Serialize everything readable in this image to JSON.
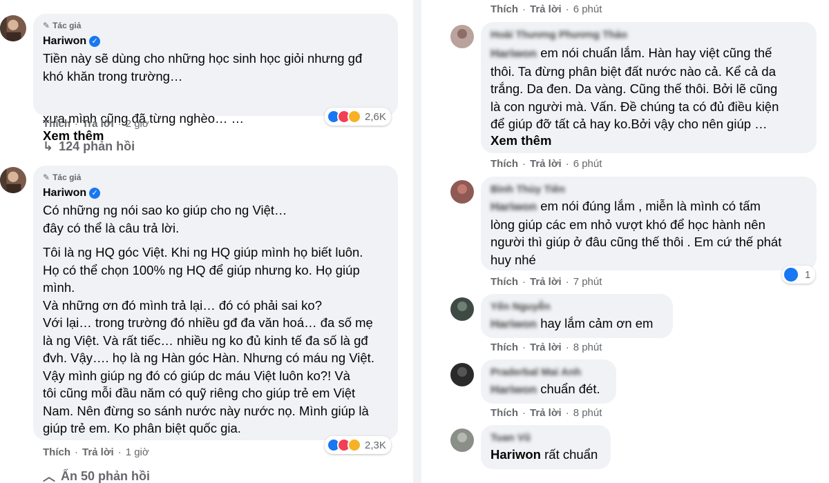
{
  "left": {
    "comments": [
      {
        "author_badge": "Tác giả",
        "author": "Hariwon",
        "paragraphs": [
          "Tiền này sẽ dùng cho những học sinh học giỏi nhưng gđ\nkhó khăn trong trường…",
          "xưa mình cũng đã từng nghèo… …"
        ],
        "see_more": "Xem thêm",
        "like": "Thích",
        "reply": "Trả lời",
        "time": "2 giờ",
        "reaction_count": "2,6K",
        "replies_label": "124 phản hồi"
      },
      {
        "author_badge": "Tác giả",
        "author": "Hariwon",
        "paragraphs": [
          "Có những ng nói sao ko giúp cho ng Việt…\nđây có thể là câu trả lời.",
          "Tôi là ng HQ góc Việt. Khi ng HQ giúp mình họ biết luôn.\nHọ có thể chọn 100% ng HQ để giúp nhưng ko. Họ giúp\nmình.\nVà những ơn đó mình trả lại… đó có phải sai ko?\nVới lại… trong trường đó nhiều gđ đa văn hoá… đa số mẹ\nlà ng Việt. Và rất tiếc… nhiều ng ko đủ kinh tế đa số là gđ\nđvh. Vậy…. họ là ng Hàn góc Hàn. Nhưng có máu ng Việt.\nVậy mình giúp ng đó có giúp dc máu Việt luôn ko?! Và\ntôi cũng mỗi đầu năm có quỹ riêng cho giúp trẻ em Việt\nNam. Nên đừng so sánh nước này nước nọ. Mình giúp là\ngiúp trẻ em. Ko phân biệt quốc gia."
        ],
        "like": "Thích",
        "reply": "Trả lời",
        "time": "1 giờ",
        "reaction_count": "2,3K",
        "replies_label": "Ẩn 50 phản hồi"
      }
    ]
  },
  "right": {
    "top_meta": {
      "like": "Thích",
      "reply": "Trả lời",
      "time": "6 phút"
    },
    "comments": [
      {
        "name": "Hoài Thương Phương Thảo",
        "mention": "Hariwon",
        "text": " em nói chuẩn lắm. Hàn hay việt cũng thế\nthôi. Ta đừng phân biệt đất nước nào cả. Kể cả da\ntrắng. Da đen. Da vàng. Cũng thế thôi. Bởi lẽ cũng\nlà con người mà. Vấn. Đề chúng ta có đủ điều kiện\nđể giúp đỡ tất cả hay ko.Bởi vậy cho nên giúp …",
        "see_more": "Xem thêm",
        "like": "Thích",
        "reply": "Trả lời",
        "time": "6 phút"
      },
      {
        "name": "Bình Thùy Tiên",
        "mention": "Hariwon",
        "text": " em nói đúng lắm , miễn là mình có tấm\nlòng giúp các em nhỏ vượt khó để học hành nên\nngười thì giúp ở đâu cũng thế thôi . Em cứ thế phát\nhuy nhé",
        "like": "Thích",
        "reply": "Trả lời",
        "time": "7 phút",
        "reaction_count": "1"
      },
      {
        "name": "Yến Nguyễn",
        "mention": "Hariwon",
        "text": " hay lắm cảm ơn em",
        "like": "Thích",
        "reply": "Trả lời",
        "time": "8 phút"
      },
      {
        "name": "Praderbal Mai Anh",
        "mention": "Hariwon",
        "text": " chuẩn đét.",
        "like": "Thích",
        "reply": "Trả lời",
        "time": "8 phút"
      },
      {
        "name": "Tuan Vũ",
        "mention": "Hariwon",
        "text": " rất chuẩn"
      }
    ]
  },
  "colors": {
    "bubble": "#f0f2f5",
    "meta_text": "#65676b",
    "accent": "#1877f2",
    "love": "#f33e58",
    "care": "#f7b125"
  },
  "icons": {
    "author": "pencil-icon",
    "verified": "verified-badge-icon",
    "reply_arrow": "reply-arrow-icon",
    "collapse": "chevron-up-icon"
  }
}
